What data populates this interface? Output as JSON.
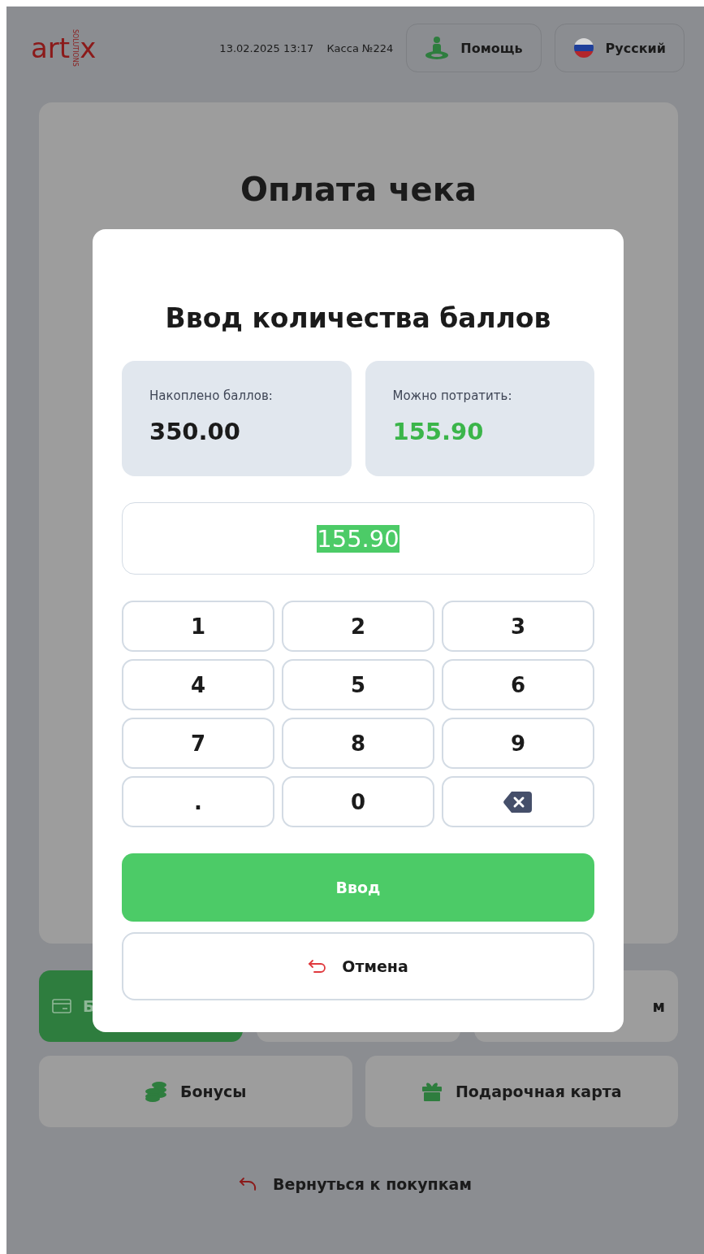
{
  "header": {
    "logo": {
      "left": "art",
      "right": "x",
      "tagline": "SOLUTIONS"
    },
    "datetime": "13.02.2025 13:17",
    "register": "Касса №224",
    "help_button": "Помощь",
    "language_button": "Русский"
  },
  "page": {
    "title": "Оплата чека"
  },
  "payment_methods": [
    {
      "label": "Б",
      "selected": true,
      "kind": "card"
    },
    {
      "selected": false
    },
    {
      "label": "м",
      "selected": false
    }
  ],
  "extra_methods": [
    {
      "label": "Бонусы",
      "kind": "coins"
    },
    {
      "label": "Подарочная карта",
      "kind": "gift"
    }
  ],
  "back_link": "Вернуться к покупкам",
  "dialog": {
    "title": "Ввод количества баллов",
    "stats": [
      {
        "label": "Накоплено баллов:",
        "value": "350.00",
        "highlight": false
      },
      {
        "label": "Можно потратить:",
        "value": "155.90",
        "highlight": true
      }
    ],
    "amount_field": {
      "value": "155.90",
      "selected": true
    },
    "keypad": [
      {
        "kind": "digit",
        "label": "1"
      },
      {
        "kind": "digit",
        "label": "2"
      },
      {
        "kind": "digit",
        "label": "3"
      },
      {
        "kind": "digit",
        "label": "4"
      },
      {
        "kind": "digit",
        "label": "5"
      },
      {
        "kind": "digit",
        "label": "6"
      },
      {
        "kind": "digit",
        "label": "7"
      },
      {
        "kind": "digit",
        "label": "8"
      },
      {
        "kind": "digit",
        "label": "9"
      },
      {
        "kind": "digit",
        "label": "."
      },
      {
        "kind": "digit",
        "label": "0"
      },
      {
        "kind": "backspace"
      }
    ],
    "enter_button": "Ввод",
    "cancel_button": "Отмена"
  }
}
